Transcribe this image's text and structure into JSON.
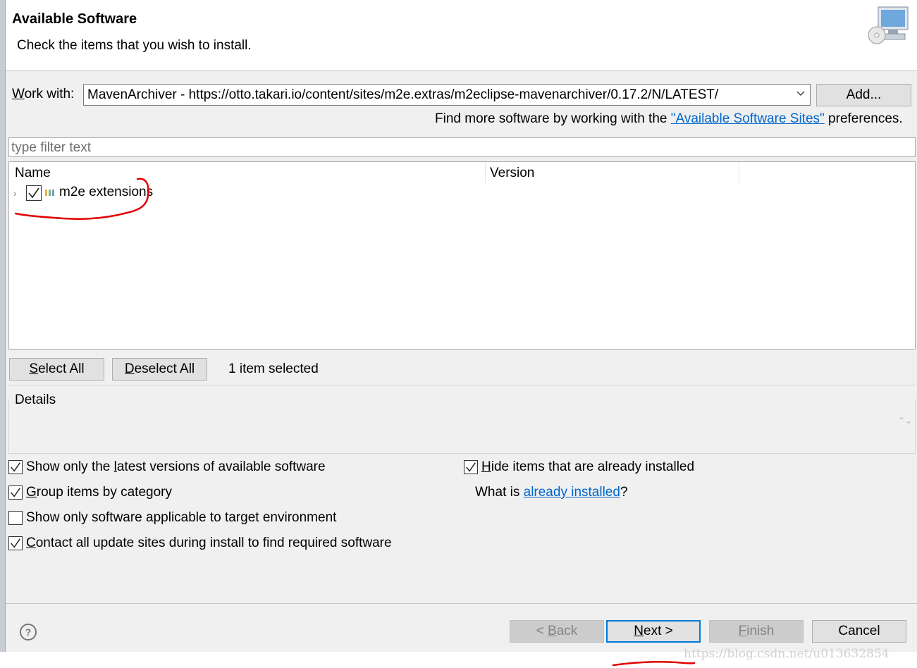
{
  "header": {
    "title": "Available Software",
    "subtitle": "Check the items that you wish to install."
  },
  "workwith": {
    "label_mnemonic": "W",
    "label_rest": "ork with:",
    "value": "MavenArchiver - https://otto.takari.io/content/sites/m2e.extras/m2eclipse-mavenarchiver/0.17.2/N/LATEST/",
    "add_label": "Add..."
  },
  "findmore": {
    "prefix": "Find more software by working with the ",
    "link": "\"Available Software Sites\"",
    "suffix": " preferences."
  },
  "filter": {
    "placeholder": "type filter text"
  },
  "tree": {
    "columns": {
      "name": "Name",
      "version": "Version"
    },
    "items": [
      {
        "label": "m2e extensions",
        "version": "",
        "checked": true,
        "expander": "›"
      }
    ]
  },
  "selection": {
    "select_all_mn": "S",
    "select_all_rest": "elect All",
    "deselect_all_mn": "D",
    "deselect_all_rest": "eselect All",
    "count": "1 item selected"
  },
  "details": {
    "label": "Details",
    "scroll": "⌃⌄"
  },
  "options": {
    "latest_pre": "Show only the ",
    "latest_mn": "l",
    "latest_post": "atest versions of available software",
    "group_mn": "G",
    "group_post": "roup items by category",
    "applicable": "Show only software applicable to target environment",
    "contact_mn": "C",
    "contact_post": "ontact all update sites during install to find required software",
    "hide_mn": "H",
    "hide_post": "ide items that are already installed",
    "whatis_pre": "What is ",
    "whatis_link": "already installed",
    "whatis_post": "?",
    "checked": {
      "latest": true,
      "group": true,
      "applicable": false,
      "contact": true,
      "hide": true
    }
  },
  "footer": {
    "help": "?",
    "back_pre": "< ",
    "back_mn": "B",
    "back_post": "ack",
    "next_mn": "N",
    "next_post": "ext >",
    "finish_mn": "F",
    "finish_post": "inish",
    "cancel": "Cancel"
  },
  "watermark": "https://blog.csdn.net/u013632854",
  "icons": [
    "wizard-banner-icon",
    "dropdown-arrow-icon",
    "check-icon",
    "category-icon",
    "help-icon",
    "scroll-arrows-icon"
  ],
  "colors": {
    "link": "#0066cc",
    "annotation": "#e00000",
    "default_button_border": "#0078d7"
  }
}
